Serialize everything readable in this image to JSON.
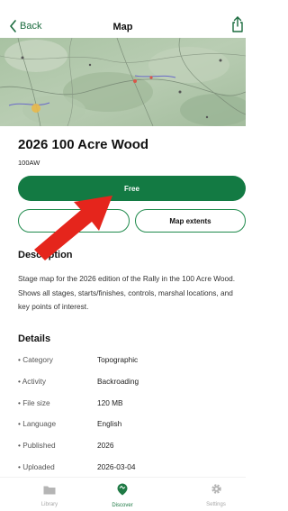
{
  "header": {
    "back_label": "Back",
    "title": "Map"
  },
  "map": {
    "title": "2026 100 Acre Wood",
    "code": "100AW"
  },
  "actions": {
    "primary_label": "Free",
    "secondary_left_label": "",
    "secondary_right_label": "Map extents"
  },
  "description": {
    "heading": "Description",
    "text": "Stage map for the 2026 edition of the Rally in the 100 Acre Wood. Shows all stages, starts/finishes, controls, marshal locations, and key points of interest."
  },
  "details": {
    "heading": "Details",
    "rows": [
      {
        "label": "Category",
        "value": "Topographic"
      },
      {
        "label": "Activity",
        "value": "Backroading"
      },
      {
        "label": "File size",
        "value": "120 MB"
      },
      {
        "label": "Language",
        "value": "English"
      },
      {
        "label": "Published",
        "value": "2026"
      },
      {
        "label": "Uploaded",
        "value": "2026-03-04"
      }
    ]
  },
  "tabbar": {
    "library_label": "Library",
    "discover_label": "Discover",
    "settings_label": "Settings"
  },
  "colors": {
    "accent": "#137a43",
    "accent_light": "#1f8a4c",
    "annotation_arrow": "#e5251c",
    "inactive_tab": "#a8a8a8"
  },
  "icons": {
    "back": "chevron-left-icon",
    "share": "share-icon",
    "library": "folder-icon",
    "discover": "map-pin-icon",
    "settings": "gear-icon"
  }
}
